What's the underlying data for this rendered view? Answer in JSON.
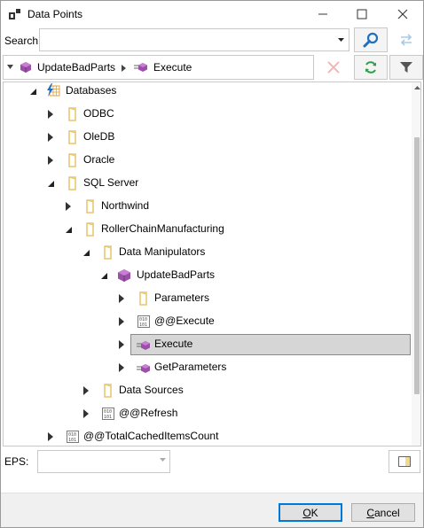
{
  "window": {
    "title": "Data Points"
  },
  "search": {
    "label": "Search:",
    "value": "",
    "placeholder": ""
  },
  "breadcrumb": {
    "items": [
      "UpdateBadParts",
      "Execute"
    ]
  },
  "tree": {
    "nodes": [
      {
        "label": "Databases",
        "icon": "lightning-database-icon",
        "expander": "expanded"
      },
      {
        "label": "ODBC",
        "icon": "folder-icon",
        "expander": "collapsed"
      },
      {
        "label": "OleDB",
        "icon": "folder-icon",
        "expander": "collapsed"
      },
      {
        "label": "Oracle",
        "icon": "folder-icon",
        "expander": "collapsed"
      },
      {
        "label": "SQL Server",
        "icon": "folder-icon",
        "expander": "expanded"
      },
      {
        "label": "Northwind",
        "icon": "folder-icon",
        "expander": "collapsed"
      },
      {
        "label": "RollerChainManufacturing",
        "icon": "folder-icon",
        "expander": "expanded"
      },
      {
        "label": "Data Manipulators",
        "icon": "folder-icon",
        "expander": "expanded"
      },
      {
        "label": "UpdateBadParts",
        "icon": "cube-icon",
        "expander": "expanded"
      },
      {
        "label": "Parameters",
        "icon": "folder-icon",
        "expander": "collapsed"
      },
      {
        "label": "@@Execute",
        "icon": "variable-icon",
        "expander": "collapsed"
      },
      {
        "label": "Execute",
        "icon": "method-cube-icon",
        "expander": "collapsed",
        "selected": true
      },
      {
        "label": "GetParameters",
        "icon": "method-cube-icon",
        "expander": "collapsed"
      },
      {
        "label": "Data Sources",
        "icon": "folder-icon",
        "expander": "collapsed"
      },
      {
        "label": "@@Refresh",
        "icon": "variable-icon",
        "expander": "collapsed"
      },
      {
        "label": "@@TotalCachedItemsCount",
        "icon": "variable-icon",
        "expander": "collapsed"
      }
    ]
  },
  "eps": {
    "label": "EPS:",
    "value": ""
  },
  "buttons": {
    "ok": "OK",
    "cancel": "Cancel"
  },
  "colors": {
    "accent": "#0078d7",
    "cube": "#9b4fa8",
    "folder": "#e8c46a",
    "selected_bg": "#d6d6d6",
    "delete_disabled": "#f3b7b7",
    "swap_disabled": "#a9c9e8"
  }
}
